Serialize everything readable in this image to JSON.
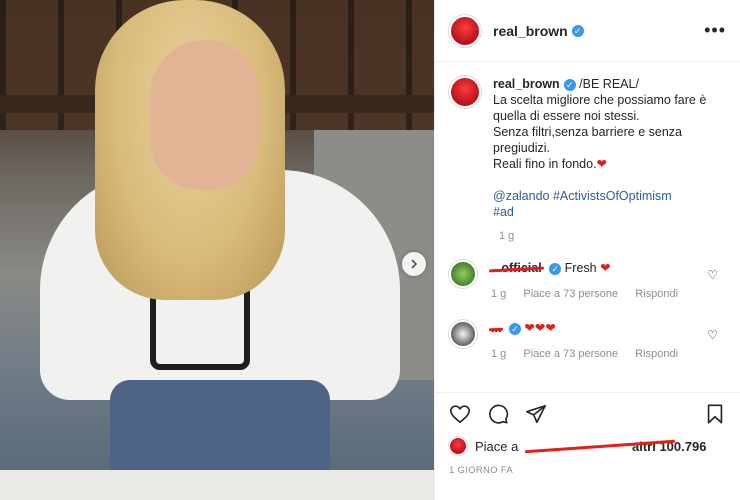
{
  "post": {
    "username": "real_brown",
    "caption": {
      "title": "/BE REAL/",
      "line1": "La scelta migliore che possiamo fare è",
      "line2": "quella di essere noi stessi.",
      "line3": "Senza filtri,senza barriere e senza",
      "line4": "pregiudizi.",
      "line5": "Reali fino in fondo.",
      "tags1": "@zalando #ActivistsOfOptimism",
      "tags2": "#ad",
      "time": "1 g"
    },
    "comments": [
      {
        "user": "...official",
        "text": "Fresh",
        "time": "1 g",
        "likes": "Piace a 73 persone",
        "reply": "Rispondi"
      },
      {
        "user": "...",
        "text": "",
        "time": "1 g",
        "likes": "Piace a 73 persone",
        "reply": "Rispondi"
      }
    ],
    "likes_text": "Piace a",
    "likes_count": "altri 100.796",
    "date": "1 GIORNO FA"
  },
  "icons": {
    "like": "heart-outline",
    "comment": "speech-bubble",
    "share": "paper-plane",
    "save": "bookmark"
  },
  "colors": {
    "verified": "#3897f0",
    "heart": "#e0201a",
    "hashtag": "#2f5c9a"
  }
}
